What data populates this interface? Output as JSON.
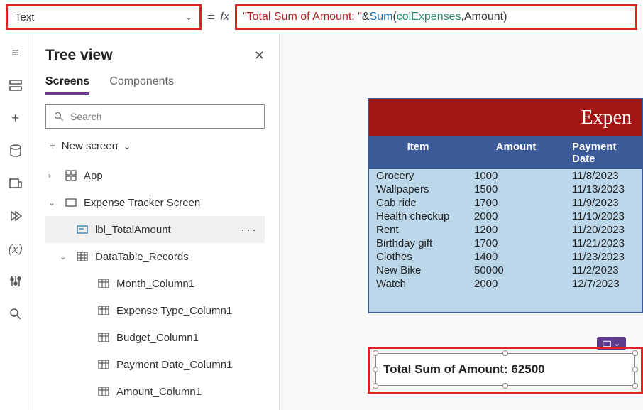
{
  "property_selector": {
    "value": "Text"
  },
  "formula": {
    "string": "\"Total Sum of Amount: \"",
    "amp": " & ",
    "fn": "Sum",
    "open": "(",
    "arg1": "colExpenses",
    "comma": ",",
    "arg2": "Amount",
    "close": ")"
  },
  "tree": {
    "title": "Tree view",
    "tabs": {
      "screens": "Screens",
      "components": "Components"
    },
    "search_placeholder": "Search",
    "new_screen": "New screen",
    "items": {
      "app": "App",
      "screen": "Expense Tracker Screen",
      "lbl": "lbl_TotalAmount",
      "table": "DataTable_Records",
      "cols": [
        "Month_Column1",
        "Expense Type_Column1",
        "Budget_Column1",
        "Payment Date_Column1",
        "Amount_Column1"
      ]
    }
  },
  "app": {
    "header": "Expen",
    "columns": {
      "item": "Item",
      "amount": "Amount",
      "date": "Payment Date"
    },
    "rows": [
      {
        "item": "Grocery",
        "amount": "1000",
        "date": "11/8/2023"
      },
      {
        "item": "Wallpapers",
        "amount": "1500",
        "date": "11/13/2023"
      },
      {
        "item": "Cab ride",
        "amount": "1700",
        "date": "11/9/2023"
      },
      {
        "item": "Health checkup",
        "amount": "2000",
        "date": "11/10/2023"
      },
      {
        "item": "Rent",
        "amount": "1200",
        "date": "11/20/2023"
      },
      {
        "item": "Birthday gift",
        "amount": "1700",
        "date": "11/21/2023"
      },
      {
        "item": "Clothes",
        "amount": "1400",
        "date": "11/23/2023"
      },
      {
        "item": "New Bike",
        "amount": "50000",
        "date": "11/2/2023"
      },
      {
        "item": "Watch",
        "amount": "2000",
        "date": "12/7/2023"
      }
    ],
    "total_label": "Total Sum of Amount: 62500"
  }
}
